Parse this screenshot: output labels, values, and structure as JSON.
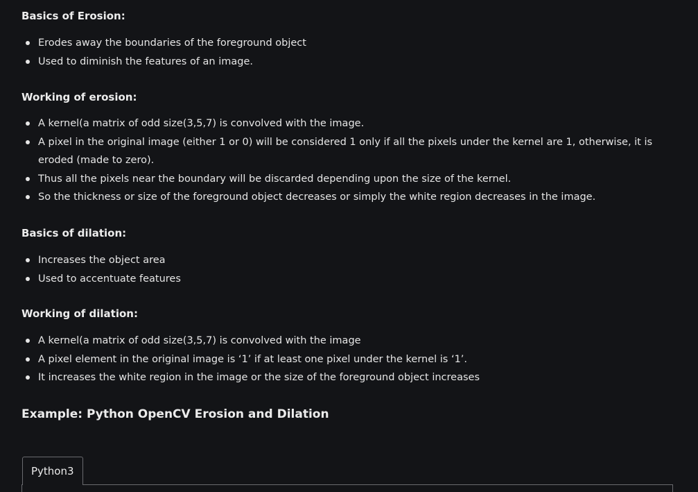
{
  "sections": {
    "erosion_basics": {
      "heading": "Basics of Erosion:",
      "items": [
        "Erodes away the boundaries of the foreground object",
        "Used to diminish the features of an image."
      ]
    },
    "erosion_working": {
      "heading": "Working of erosion:",
      "items": [
        "A kernel(a matrix of odd size(3,5,7) is convolved with the image.",
        "A pixel in the original image (either 1 or 0) will be considered 1 only if all the pixels under the kernel are 1, otherwise, it is eroded (made to zero).",
        "Thus all the pixels near the boundary will be discarded depending upon the size of the kernel.",
        "So the thickness or size of the foreground object decreases or simply the white region decreases in the image."
      ]
    },
    "dilation_basics": {
      "heading": "Basics of dilation:",
      "items": [
        "Increases the object area",
        "Used to accentuate features"
      ]
    },
    "dilation_working": {
      "heading": "Working of dilation:",
      "items": [
        "A kernel(a matrix of odd size(3,5,7) is convolved with the image",
        "A pixel element in the original image is ‘1’ if at least one pixel under the kernel is ‘1’.",
        "It increases the white region in the image or the size of the foreground object increases"
      ]
    }
  },
  "example": {
    "heading": "Example: Python OpenCV Erosion and Dilation"
  },
  "code_tabs": {
    "active_tab": "Python3"
  }
}
